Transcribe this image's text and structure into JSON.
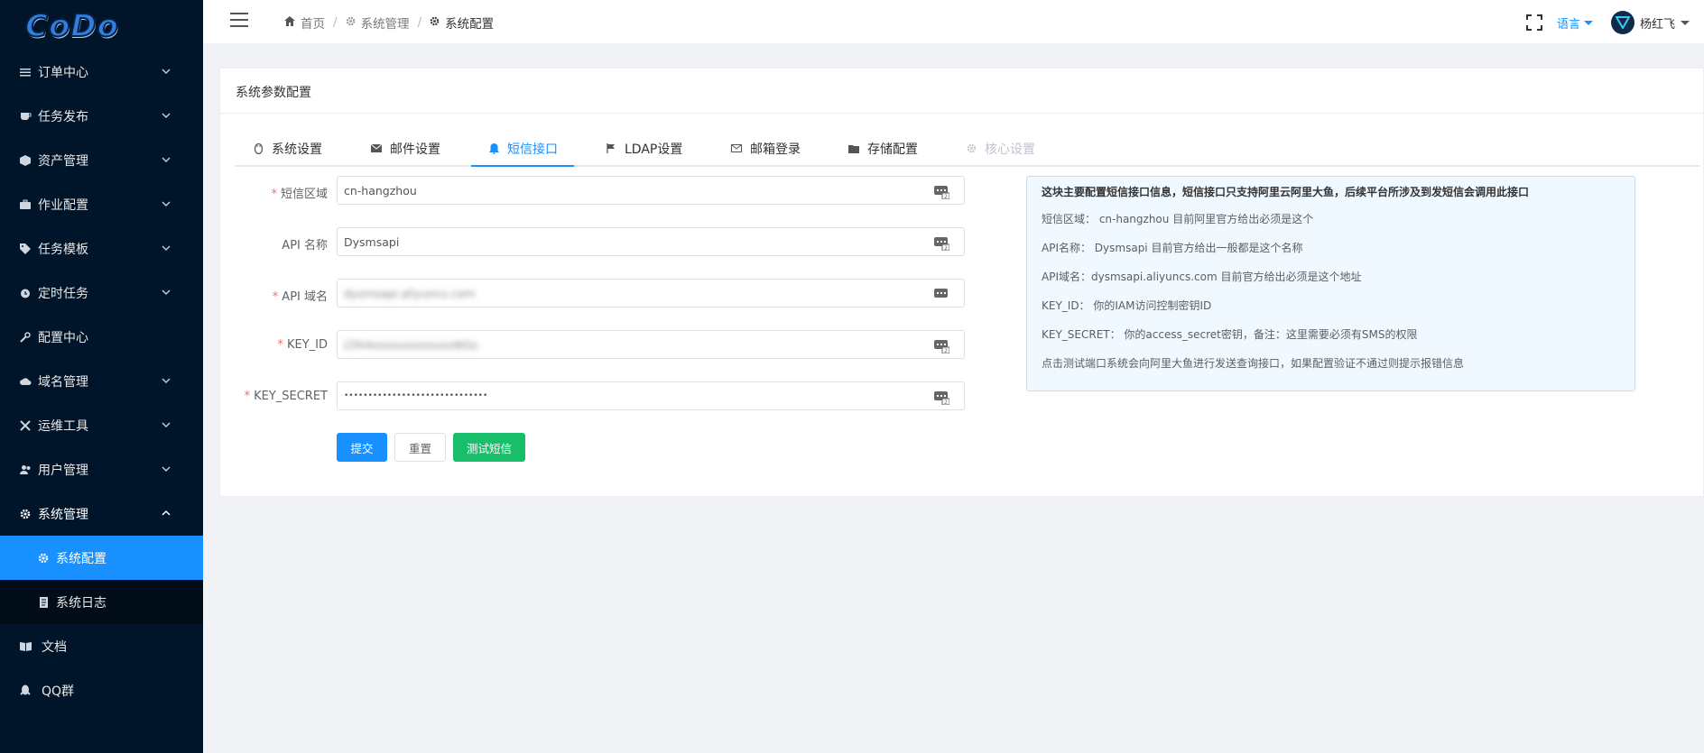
{
  "app": {
    "logo_text": "CoDo"
  },
  "sidebar": {
    "items": [
      {
        "label": "订单中心",
        "icon": "list-icon",
        "expandable": true
      },
      {
        "label": "任务发布",
        "icon": "coffee-icon",
        "expandable": true
      },
      {
        "label": "资产管理",
        "icon": "cube-icon",
        "expandable": true
      },
      {
        "label": "作业配置",
        "icon": "briefcase-icon",
        "expandable": true
      },
      {
        "label": "任务模板",
        "icon": "tag-icon",
        "expandable": true
      },
      {
        "label": "定时任务",
        "icon": "clock-icon",
        "expandable": true
      },
      {
        "label": "配置中心",
        "icon": "wrench-icon",
        "expandable": false
      },
      {
        "label": "域名管理",
        "icon": "cloud-icon",
        "expandable": true
      },
      {
        "label": "运维工具",
        "icon": "tools-icon",
        "expandable": true
      },
      {
        "label": "用户管理",
        "icon": "users-icon",
        "expandable": true
      },
      {
        "label": "系统管理",
        "icon": "gear-icon",
        "expandable": true,
        "expanded": true
      }
    ],
    "sub_items": [
      {
        "label": "系统配置",
        "icon": "gear-icon",
        "active": true
      },
      {
        "label": "系统日志",
        "icon": "document-icon",
        "active": false
      }
    ],
    "bottom_items": [
      {
        "label": "文档",
        "icon": "book-icon"
      },
      {
        "label": "QQ群",
        "icon": "qq-icon"
      }
    ]
  },
  "header": {
    "breadcrumb": [
      "首页",
      "系统管理",
      "系统配置"
    ],
    "language": "语言",
    "user": "杨红飞"
  },
  "card": {
    "title": "系统参数配置",
    "tabs": [
      {
        "label": "系统设置",
        "icon": "linux-icon"
      },
      {
        "label": "邮件设置",
        "icon": "mail-icon"
      },
      {
        "label": "短信接口",
        "icon": "bell-icon",
        "active": true
      },
      {
        "label": "LDAP设置",
        "icon": "flag-icon"
      },
      {
        "label": "邮箱登录",
        "icon": "envelope-icon"
      },
      {
        "label": "存储配置",
        "icon": "folder-icon"
      },
      {
        "label": "核心设置",
        "icon": "gear-icon",
        "disabled": true
      }
    ],
    "form": {
      "fields": [
        {
          "label": "短信区域",
          "required": true,
          "value": "cn-hangzhou"
        },
        {
          "label": "API 名称",
          "required": false,
          "value": "Dysmsapi"
        },
        {
          "label": "API 域名",
          "required": true,
          "value": "dysmsapi.aliyuncs.com"
        },
        {
          "label": "KEY_ID",
          "required": true,
          "value": "LTAI4xxxxxxxxxxxxWGc"
        },
        {
          "label": "KEY_SECRET",
          "required": true,
          "value": "••••••••••••••••••••••••••••••"
        }
      ],
      "buttons": {
        "submit": "提交",
        "reset": "重置",
        "test": "测试短信"
      }
    },
    "info": {
      "title": "这块主要配置短信接口信息，短信接口只支持阿里云阿里大鱼，后续平台所涉及到发短信会调用此接口",
      "lines": [
        "短信区域： cn-hangzhou 目前阿里官方给出必须是这个",
        "API名称： Dysmsapi 目前官方给出一般都是这个名称",
        "API域名：dysmsapi.aliyuncs.com 目前官方给出必须是这个地址",
        "KEY_ID： 你的IAM访问控制密钥ID",
        "KEY_SECRET： 你的access_secret密钥，备注：这里需要必须有SMS的权限",
        "点击测试端口系统会向阿里大鱼进行发送查询接口，如果配置验证不通过则提示报错信息"
      ]
    }
  }
}
